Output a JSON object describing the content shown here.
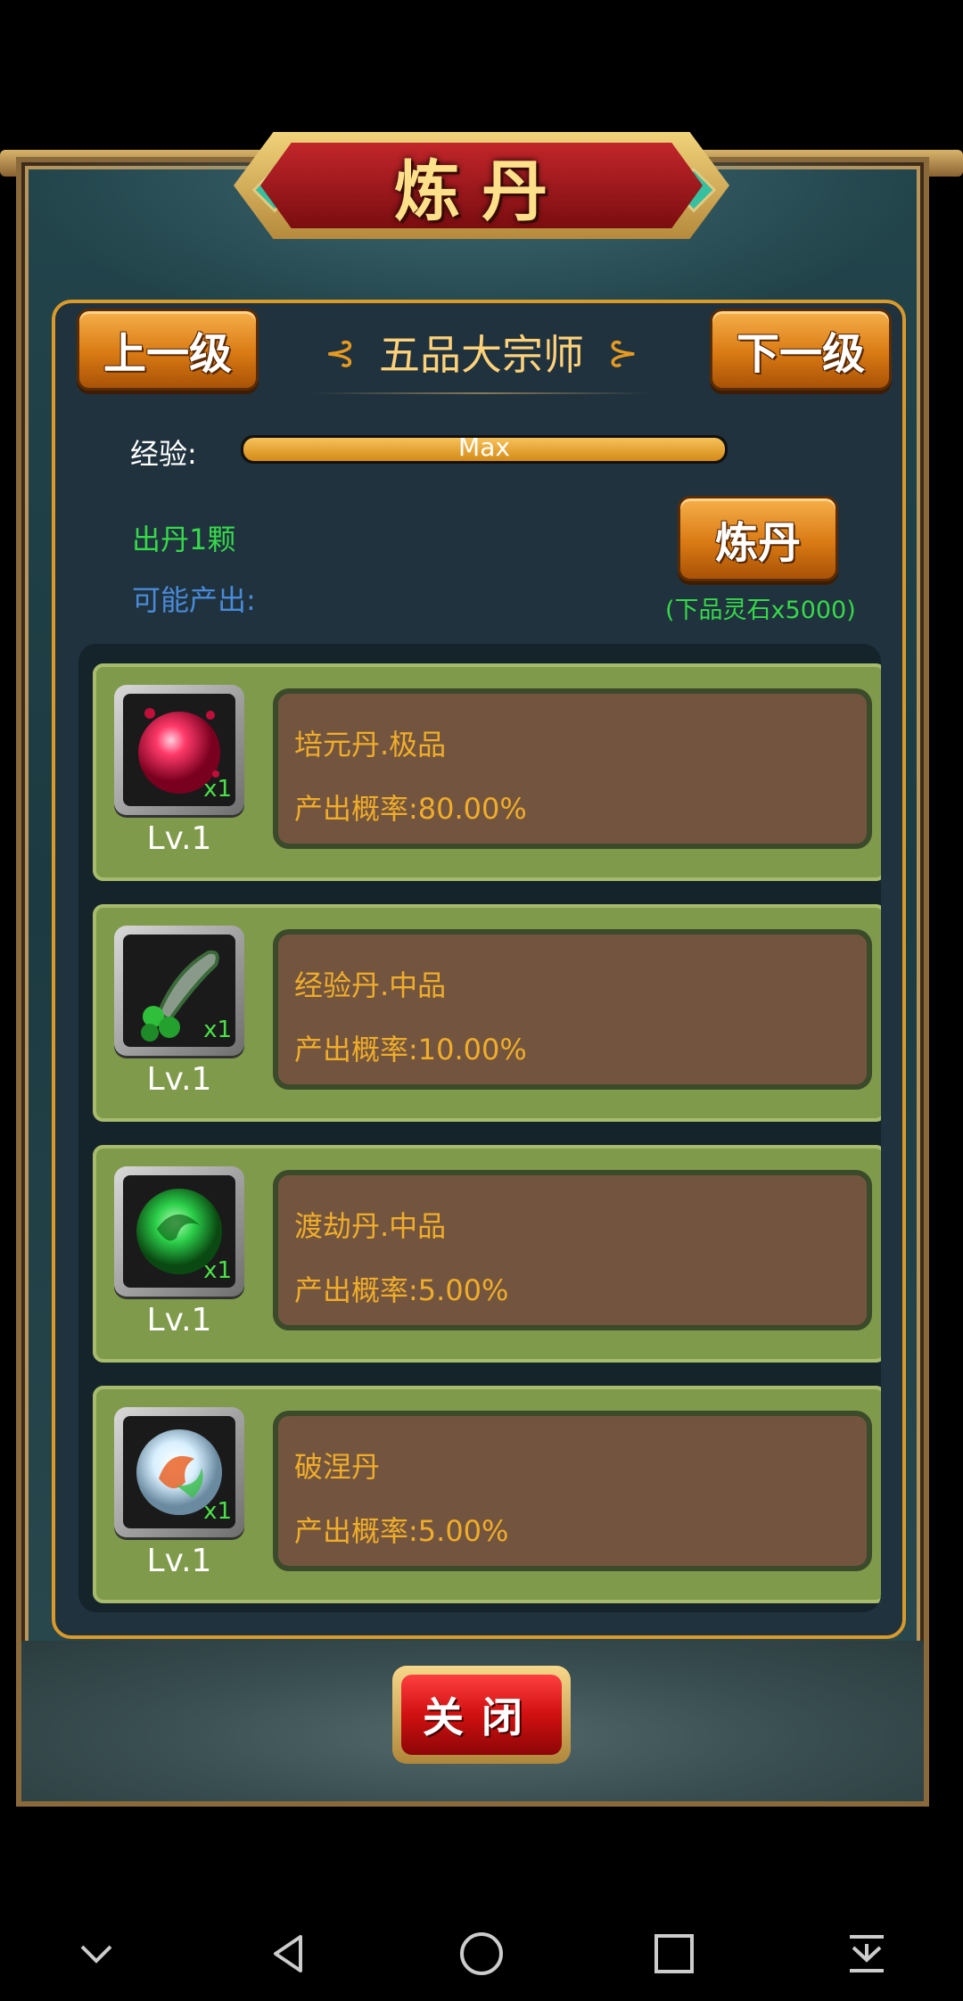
{
  "window": {
    "title": "炼丹"
  },
  "nav": {
    "prev_label": "上一级",
    "next_label": "下一级",
    "rank_title": "五品大宗师"
  },
  "experience": {
    "label": "经验:",
    "value_text": "Max",
    "progress": 1.0
  },
  "craft": {
    "output_count": "出丹1颗",
    "possible_label": "可能产出:",
    "button_label": "炼丹",
    "cost": "(下品灵石x5000)"
  },
  "items": [
    {
      "name": "培元丹.极品",
      "rate": "产出概率:80.00%",
      "level": "Lv.1",
      "qty": "x1",
      "icon": "red-pill-icon"
    },
    {
      "name": "经验丹.中品",
      "rate": "产出概率:10.00%",
      "level": "Lv.1",
      "qty": "x1",
      "icon": "green-beads-icon"
    },
    {
      "name": "渡劫丹.中品",
      "rate": "产出概率:5.00%",
      "level": "Lv.1",
      "qty": "x1",
      "icon": "green-swirl-orb-icon"
    },
    {
      "name": "破涅丹",
      "rate": "产出概率:5.00%",
      "level": "Lv.1",
      "qty": "x1",
      "icon": "rainbow-orb-icon"
    }
  ],
  "footer": {
    "close_label": "关闭"
  },
  "system_nav": [
    "chevron-down-icon",
    "back-icon",
    "home-icon",
    "recents-icon",
    "download-icon"
  ],
  "colors": {
    "accent_orange": "#d97a14",
    "title_red": "#c2262a",
    "rate_text": "#f0ad2a",
    "green_text": "#37d94a",
    "blue_text": "#4a8bd8"
  }
}
